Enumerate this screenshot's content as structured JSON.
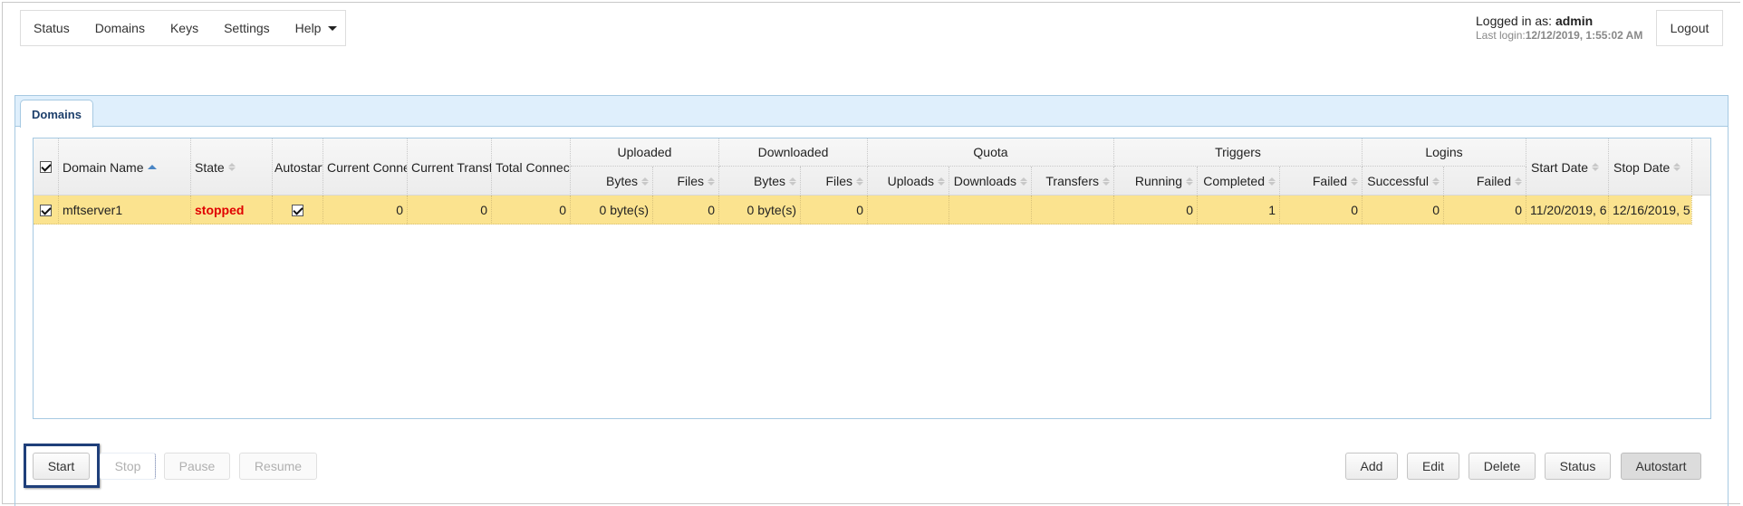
{
  "nav": {
    "items": [
      "Status",
      "Domains",
      "Keys",
      "Settings",
      "Help"
    ]
  },
  "user": {
    "logged_in_label": "Logged in as: ",
    "username": "admin",
    "last_login_label": "Last login:",
    "last_login_value": "12/12/2019, 1:55:02 AM",
    "logout_label": "Logout"
  },
  "tabs": [
    {
      "label": "Domains",
      "active": true
    }
  ],
  "grid": {
    "columns": {
      "domain_name": "Domain Name",
      "state": "State",
      "autostart": "Autostart",
      "current_conn": "Current Connections",
      "current_trans": "Current Transfers",
      "total_connect": "Total Connections",
      "uploaded": "Uploaded",
      "downloaded": "Downloaded",
      "quota": "Quota",
      "triggers": "Triggers",
      "logins": "Logins",
      "bytes": "Bytes",
      "files": "Files",
      "uploads": "Uploads",
      "downloads": "Downloads",
      "transfers": "Transfers",
      "running": "Running",
      "completed": "Completed",
      "failed": "Failed",
      "successful": "Successful",
      "start_date": "Start Date",
      "stop_date": "Stop Date"
    },
    "select_all_checked": true,
    "rows": [
      {
        "selected": true,
        "domain_name": "mftserver1",
        "state": "stopped",
        "autostart": true,
        "current_conn": "0",
        "current_trans": "0",
        "total_connect": "0",
        "uploaded_bytes": "0 byte(s)",
        "uploaded_files": "0",
        "downloaded_bytes": "0 byte(s)",
        "downloaded_files": "0",
        "quota_uploads": "",
        "quota_downloads": "",
        "quota_transfers": "",
        "triggers_running": "0",
        "triggers_completed": "1",
        "triggers_failed": "0",
        "logins_successful": "0",
        "logins_failed": "0",
        "start_date": "11/20/2019, 6",
        "stop_date": "12/16/2019, 5"
      }
    ]
  },
  "actions": {
    "left": [
      "Start",
      "Stop",
      "Pause",
      "Resume"
    ],
    "right": [
      "Add",
      "Edit",
      "Delete",
      "Status",
      "Autostart"
    ]
  },
  "colors": {
    "selected_row": "#fbe38f",
    "state_stopped": "#e00000",
    "tab_bar": "#dfeffc",
    "focus_highlight": "#1f3f7a"
  }
}
